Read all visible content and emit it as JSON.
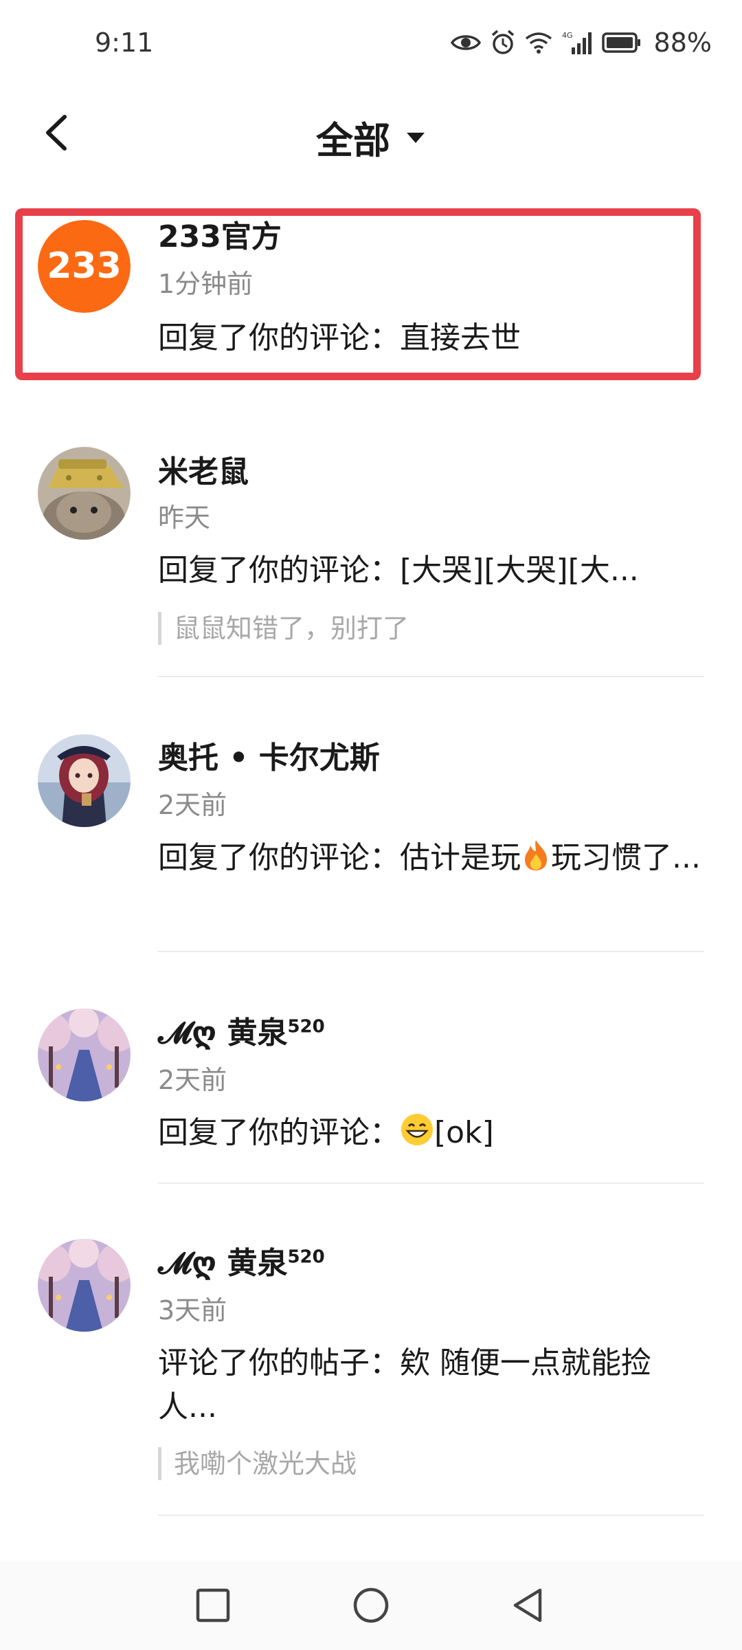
{
  "status_bar": {
    "time": "9:11",
    "network": "4G",
    "battery": "88%"
  },
  "header": {
    "title": "全部"
  },
  "notifications": [
    {
      "name": "233官方",
      "avatar_text": "233",
      "time": "1分钟前",
      "message": "回复了你的评论：直接去世",
      "highlighted": true
    },
    {
      "name": "米老鼠",
      "time": "昨天",
      "message": "回复了你的评论：[大哭][大哭][大...",
      "quote": "鼠鼠知错了，别打了"
    },
    {
      "name": "奥托 • 卡尔尤斯",
      "time": "2天前",
      "message_before": "回复了你的评论：估计是玩",
      "message_after": "玩习惯了...",
      "emoji": "fire"
    },
    {
      "name_prefix": "𝓜ღ",
      "name": "黄泉",
      "name_sup": "520",
      "time": "2天前",
      "message_before": "回复了你的评论：",
      "message_after": "[ok]",
      "emoji": "grin"
    },
    {
      "name_prefix": "𝓜ღ",
      "name": "黄泉",
      "name_sup": "520",
      "time": "3天前",
      "message": "评论了你的帖子：欸 随便一点就能捡人...",
      "quote": "我嘞个激光大战"
    }
  ],
  "colors": {
    "highlight": "#e8404a",
    "brand_orange": "#fb6a12"
  }
}
